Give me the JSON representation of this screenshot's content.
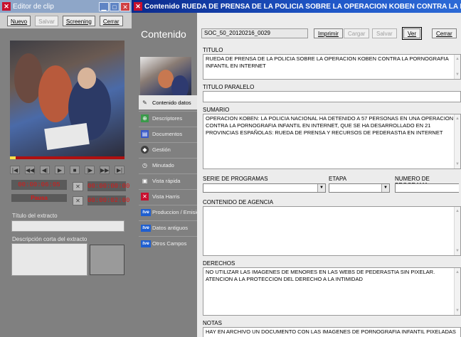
{
  "left_window": {
    "title": "Editor de clip",
    "toolbar": {
      "new": "Nuevo",
      "save": "Salvar",
      "screening": "Screening",
      "close": "Cerrar"
    },
    "timecodes": {
      "current": "00:00:06:05",
      "state": "Pausa",
      "mark_in": "00:00:00:00",
      "mark_out": "00:00:02:00"
    },
    "extract_title_label": "Título del extracto",
    "extract_desc_label": "Descripción corta del extracto"
  },
  "right_window": {
    "title": "Contenido RUEDA DE PRENSA DE LA POLICIA SOBRE LA OPERACION KOBEN CONTRA LA PORNOGRAFIA INFANT...",
    "nav_heading": "Contenido",
    "content_id": "SOC_50_20120216_0029",
    "toolbar": {
      "print": "Imprimir",
      "load": "Cargar",
      "save": "Salvar",
      "view": "Ver",
      "close": "Cerrar"
    },
    "nav_items": [
      {
        "label": "Contenido datos",
        "icon": "edit-icon"
      },
      {
        "label": "Descriptores",
        "icon": "descriptors-icon"
      },
      {
        "label": "Documentos",
        "icon": "documents-icon"
      },
      {
        "label": "Gestión",
        "icon": "management-icon"
      },
      {
        "label": "Minutado",
        "icon": "timing-icon"
      },
      {
        "label": "Vista rápida",
        "icon": "quick-view-icon"
      },
      {
        "label": "Vista Harris",
        "icon": "harris-icon"
      },
      {
        "label": "Produccion / Emision",
        "icon": "tve-logo-icon"
      },
      {
        "label": "Datos antiguos",
        "icon": "tve-logo-icon"
      },
      {
        "label": "Otros Campos",
        "icon": "tve-logo-icon"
      }
    ],
    "fields": {
      "titulo_label": "TITULO",
      "titulo_value": "RUEDA DE PRENSA DE LA POLICIA SOBRE LA OPERACION KOBEN CONTRA LA PORNOGRAFIA INFANTIL EN INTERNET",
      "titulo_paralelo_label": "TITULO PARALELO",
      "titulo_paralelo_value": "",
      "sumario_label": "SUMARIO",
      "sumario_value": "OPERACION KOBEN: LA POLICIA NACIONAL HA DETENIDO A 57 PERSONAS EN UNA OPERACION CONTRA LA PORNOGRAFIA INFANTIL EN INTERNET, QUE SE HA DESARROLLADO EN 21 PROVINCIAS ESPAÑOLAS: RUEDA DE PRENSA Y RECURSOS DE PEDERASTIA EN INTERNET",
      "serie_label": "SERIE DE PROGRAMAS",
      "etapa_label": "ETAPA",
      "numero_label": "NUMERO DE PROGRAMA",
      "agencia_label": "CONTENIDO DE AGENCIA",
      "agencia_value": "",
      "derechos_label": "DERECHOS",
      "derechos_value": "NO UTILIZAR LAS IMAGENES DE MENORES EN LAS WEBS DE PEDERASTIA SIN PIXELAR. ATENCION A LA PROTECCION DEL DERECHO A LA INTIMIDAD",
      "notas_label": "NOTAS",
      "notas_value": "HAY EN ARCHIVO UN DOCUMENTO CON LAS IMAGENES DE PORNOGRAFIA INFANTIL PIXELADAS"
    }
  }
}
